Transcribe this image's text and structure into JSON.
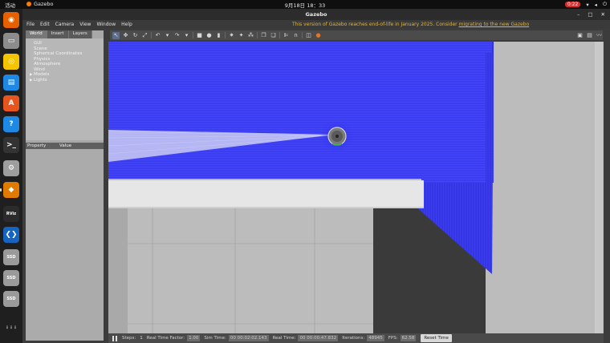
{
  "system_bar": {
    "activities": "活动",
    "app_name": "Gazebo",
    "clock": "9月18日  18：33",
    "battery": "0:22"
  },
  "dock": {
    "items": [
      {
        "name": "firefox",
        "color": "#e66000",
        "glyph": "◉"
      },
      {
        "name": "files",
        "color": "#8c8c8c",
        "glyph": "▭"
      },
      {
        "name": "rhythmbox",
        "color": "#f5c400",
        "glyph": "◎"
      },
      {
        "name": "writer",
        "color": "#1e88e5",
        "glyph": "▤"
      },
      {
        "name": "software",
        "color": "#e8541e",
        "glyph": "A"
      },
      {
        "name": "help",
        "color": "#1e88e5",
        "glyph": "?"
      },
      {
        "name": "terminal",
        "color": "#333333",
        "glyph": ">_"
      },
      {
        "name": "settings",
        "color": "#9e9e9e",
        "glyph": "⚙"
      },
      {
        "name": "gazebo",
        "color": "#e07b00",
        "glyph": "◆"
      },
      {
        "name": "rviz",
        "color": "#2b2b2b",
        "glyph": "RViz"
      },
      {
        "name": "vscode",
        "color": "#1565c0",
        "glyph": "❮❯"
      },
      {
        "name": "ssd-1",
        "color": "#9a9a9a",
        "glyph": "SSD"
      },
      {
        "name": "ssd-2",
        "color": "#9a9a9a",
        "glyph": "SSD"
      },
      {
        "name": "ssd-3",
        "color": "#9a9a9a",
        "glyph": "SSD"
      },
      {
        "name": "app-grid",
        "color": "#1f1f1f",
        "glyph": "⋮⋮⋮"
      }
    ]
  },
  "window": {
    "title": "Gazebo",
    "menu": [
      "File",
      "Edit",
      "Camera",
      "View",
      "Window",
      "Help"
    ],
    "notice_text": "This version of Gazebo reaches end-of-life in January 2025. Consider ",
    "notice_link": "migrating to the new Gazebo"
  },
  "left_panel": {
    "tabs": [
      "World",
      "Insert",
      "Layers"
    ],
    "active_tab": "World",
    "tree": [
      "GUI",
      "Scene",
      "Spherical Coordinates",
      "Physics",
      "Atmosphere",
      "Wind",
      "Models",
      "Lights"
    ],
    "expandable": [
      "Models",
      "Lights"
    ],
    "property_header": {
      "property": "Property",
      "value": "Value"
    }
  },
  "toolbar": {
    "left_tools": [
      "select-arrow",
      "translate",
      "rotate",
      "scale",
      "undo",
      "undo-dropdown",
      "redo",
      "redo-dropdown",
      "box",
      "sphere",
      "cylinder",
      "point-light",
      "spot-light",
      "directional-light",
      "copy",
      "paste",
      "align",
      "snap",
      "change-view",
      "record"
    ],
    "right_tools": [
      "screenshot",
      "log",
      "plot"
    ]
  },
  "bottom_bar": {
    "steps_label": "Steps:",
    "steps_value": "1",
    "rtf_label": "Real Time Factor:",
    "rtf_value": "1.00",
    "sim_time_label": "Sim Time:",
    "sim_time_value": "00 00:02:02.143",
    "real_time_label": "Real Time:",
    "real_time_value": "00 00:00:47.832",
    "iterations_label": "Iterations:",
    "iterations_value": "48945",
    "fps_label": "FPS:",
    "fps_value": "62.58",
    "reset_label": "Reset Time"
  },
  "colors": {
    "wall_blue": "#3a3cf0",
    "laser_rays": "#e8e8f4",
    "ground": "#bdbdbd",
    "dark_floor": "#393939",
    "white_wall": "#e6e6e6"
  }
}
